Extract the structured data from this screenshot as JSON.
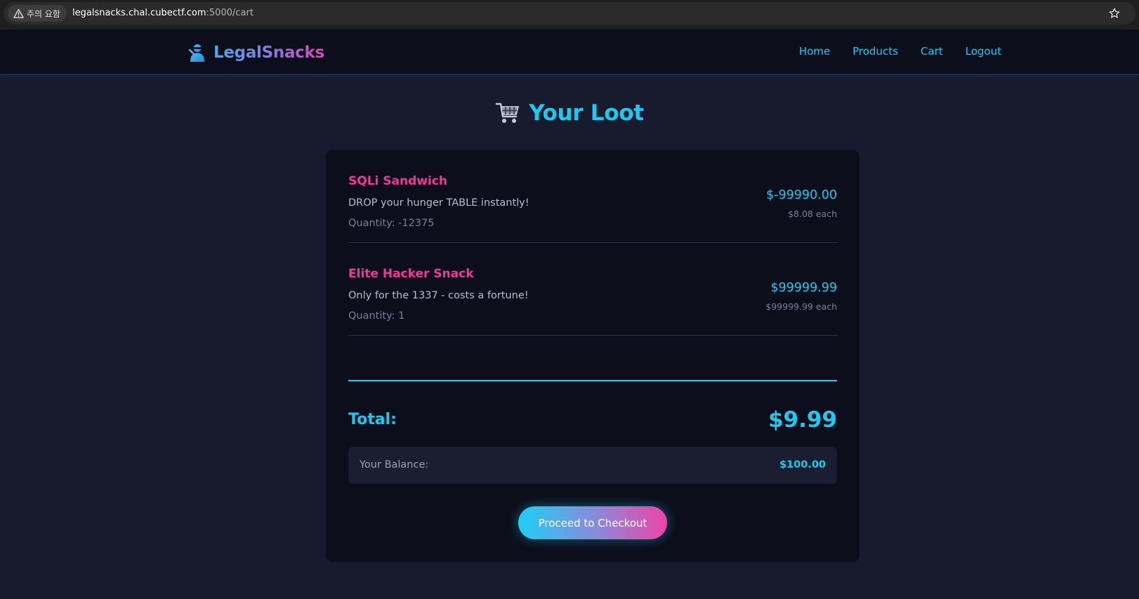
{
  "browser": {
    "security_label": "주의 요함",
    "url_host": "legalsnacks.chal.cubectf.com",
    "url_path": ":5000/cart"
  },
  "navbar": {
    "brand": "LegalSnacks",
    "brand_icon": "hacker-silhouette-icon",
    "links": [
      {
        "label": "Home"
      },
      {
        "label": "Products"
      },
      {
        "label": "Cart"
      },
      {
        "label": "Logout"
      }
    ]
  },
  "page": {
    "title": "Your Loot",
    "title_icon": "shopping-cart-icon"
  },
  "cart": {
    "items": [
      {
        "name": "SQLi Sandwich",
        "description": "DROP your hunger TABLE instantly!",
        "quantity_text": "Quantity: -12375",
        "line_total": "$-99990.00",
        "unit_price": "$8.08 each"
      },
      {
        "name": "Elite Hacker Snack",
        "description": "Only for the 1337 - costs a fortune!",
        "quantity_text": "Quantity: 1",
        "line_total": "$99999.99",
        "unit_price": "$99999.99 each"
      }
    ],
    "total_label": "Total:",
    "total_value": "$9.99",
    "balance_label": "Your Balance:",
    "balance_value": "$100.00",
    "checkout_label": "Proceed to Checkout"
  },
  "colors": {
    "accent_cyan": "#1ec8ef",
    "accent_pink": "#f0379b",
    "background": "#181a2e",
    "card": "#0d0e1b"
  }
}
